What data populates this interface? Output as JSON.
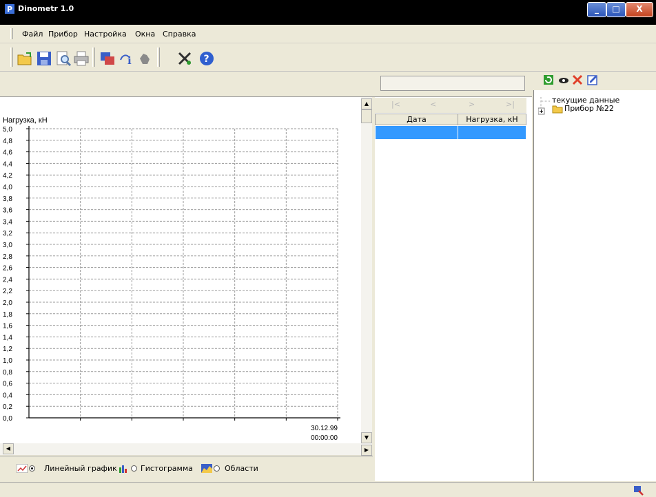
{
  "window": {
    "title": "Dinometr 1.0"
  },
  "menu": {
    "items": [
      "Файл",
      "Прибор",
      "Настройка",
      "Окна",
      "Справка"
    ]
  },
  "toolbar": {
    "icons": [
      "open-icon",
      "save-icon",
      "preview-icon",
      "print-icon",
      "device-icon",
      "info-icon",
      "hand-icon",
      "tools-icon",
      "help-icon"
    ]
  },
  "chart_data": {
    "type": "line",
    "ylabel": "Нагрузка, кН",
    "ylim": [
      0,
      5.0
    ],
    "y_ticks": [
      "0,0",
      "0,2",
      "0,4",
      "0,6",
      "0,8",
      "1,0",
      "1,2",
      "1,4",
      "1,6",
      "1,8",
      "2,0",
      "2,2",
      "2,4",
      "2,6",
      "2,8",
      "3,0",
      "3,2",
      "3,4",
      "3,6",
      "3,8",
      "4,0",
      "4,2",
      "4,4",
      "4,6",
      "4,8",
      "5,0"
    ],
    "x_tick_label": {
      "date": "30.12.99",
      "time": "00:00:00"
    },
    "grid": true,
    "series": []
  },
  "chart_options": {
    "line": "Линейный график",
    "histogram": "Гистограмма",
    "areas": "Области",
    "selected": "line"
  },
  "table": {
    "columns": [
      "Дата",
      "Нагрузка, кН"
    ],
    "nav": [
      "|<",
      "<",
      ">",
      ">|"
    ]
  },
  "tree": {
    "items": [
      {
        "label": "текущие данные"
      },
      {
        "label": "Прибор №22"
      }
    ]
  },
  "colors": {
    "title_bar": "#000000",
    "selection": "#3399ff",
    "face": "#ece9d8"
  }
}
